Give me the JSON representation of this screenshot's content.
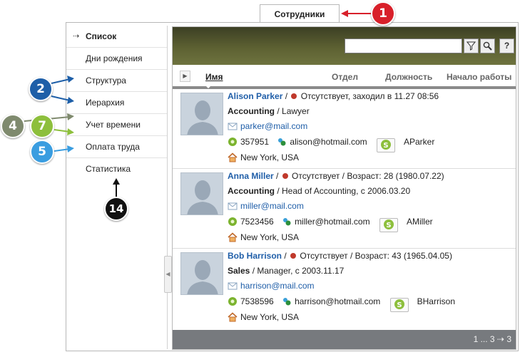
{
  "top_tab": {
    "label": "Сотрудники"
  },
  "sidebar": {
    "items": [
      {
        "label": "Список",
        "marker": "⇢",
        "active": true
      },
      {
        "label": "Дни рождения"
      },
      {
        "label": "Структура"
      },
      {
        "label": "Иерархия"
      },
      {
        "label": "Учет времени"
      },
      {
        "label": "Оплата труда"
      },
      {
        "label": "Статистика"
      }
    ]
  },
  "toolbar": {
    "search_value": "",
    "filter_icon": "filter-icon",
    "search_icon": "magnifier-icon",
    "help_label": "?"
  },
  "table": {
    "columns": [
      "Имя",
      "Отдел",
      "Должность",
      "Начало работы"
    ],
    "sorted_column": "Имя"
  },
  "employees": [
    {
      "name": "Alison Parker",
      "status": "Отсутствует, заходил в 11.27 08:56",
      "department": "Accounting",
      "position": "Lawyer",
      "email": "parker@mail.com",
      "phone": "357951",
      "messenger": "alison@hotmail.com",
      "skype": "AParker",
      "location": "New York, USA"
    },
    {
      "name": "Anna Miller",
      "status": "Отсутствует / Возраст: 28 (1980.07.22)",
      "department": "Accounting",
      "position": "Head of Accounting, с 2006.03.20",
      "email": "miller@mail.com",
      "phone": "7523456",
      "messenger": "miller@hotmail.com",
      "skype": "AMiller",
      "location": "New York, USA"
    },
    {
      "name": "Bob Harrison",
      "status": "Отсутствует / Возраст: 43 (1965.04.05)",
      "department": "Sales",
      "position": "Manager, с 2003.11.17",
      "email": "harrison@mail.com",
      "phone": "7538596",
      "messenger": "harrison@hotmail.com",
      "skype": "BHarrison",
      "location": "New York, USA"
    }
  ],
  "pagination": {
    "label": "1 ... 3 ⇢ 3"
  },
  "callouts": [
    {
      "number": "1",
      "color": "#d8202a"
    },
    {
      "number": "2",
      "color": "#1e5fa8"
    },
    {
      "number": "4",
      "color": "#7f8a6e"
    },
    {
      "number": "7",
      "color": "#8dbf3c"
    },
    {
      "number": "5",
      "color": "#3a9de0"
    },
    {
      "number": "14",
      "color": "#111111"
    }
  ]
}
